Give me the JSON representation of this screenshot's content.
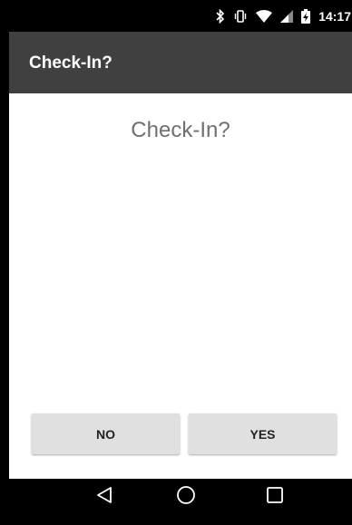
{
  "status_bar": {
    "time": "14:17",
    "icons": [
      "bluetooth-icon",
      "vibrate-icon",
      "wifi-icon",
      "signal-icon",
      "battery-charging-icon"
    ]
  },
  "action_bar": {
    "title": "Check-In?"
  },
  "content": {
    "message": "Check-In?"
  },
  "buttons": {
    "no_label": "NO",
    "yes_label": "YES"
  },
  "nav_bar": {
    "icons": [
      "back-icon",
      "home-icon",
      "recents-icon"
    ]
  }
}
